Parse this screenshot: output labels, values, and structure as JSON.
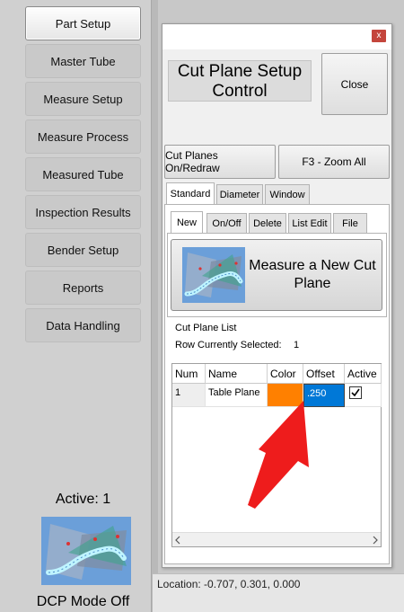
{
  "sidebar": {
    "items": [
      {
        "label": "Part Setup",
        "active": true
      },
      {
        "label": "Master Tube"
      },
      {
        "label": "Measure Setup"
      },
      {
        "label": "Measure Process"
      },
      {
        "label": "Measured Tube"
      },
      {
        "label": "Inspection Results"
      },
      {
        "label": "Bender Setup"
      },
      {
        "label": "Reports"
      },
      {
        "label": "Data Handling"
      }
    ],
    "active_label": "Active: 1",
    "mode_label": "DCP Mode Off"
  },
  "dialog": {
    "close_glyph": "x",
    "title_line1": "Cut Plane Setup",
    "title_line2": "Control",
    "close_button": "Close",
    "cut_planes_button": "Cut Planes On/Redraw",
    "zoom_button": "F3 - Zoom All",
    "tabs": [
      "Standard",
      "Diameter",
      "Window"
    ],
    "subtabs": [
      "New",
      "On/Off",
      "Delete",
      "List Edit",
      "File"
    ],
    "measure_button_line1": "Measure a New Cut",
    "measure_button_line2": "Plane",
    "list_label": "Cut Plane List",
    "row_selected_label": "Row Currently Selected:",
    "row_selected_value": "1",
    "table": {
      "headers": [
        "Num",
        "Name",
        "Color",
        "Offset",
        "Active"
      ],
      "rows": [
        {
          "num": "1",
          "name": "Table Plane",
          "color": "#ff8000",
          "offset": ".250",
          "active": true
        }
      ]
    }
  },
  "status": {
    "location": "Location: -0.707, 0.301, 0.000"
  },
  "colors": {
    "accent_selection": "#0078d7",
    "annotation_arrow": "#ee1c1c",
    "row_color_swatch": "#ff8000"
  }
}
